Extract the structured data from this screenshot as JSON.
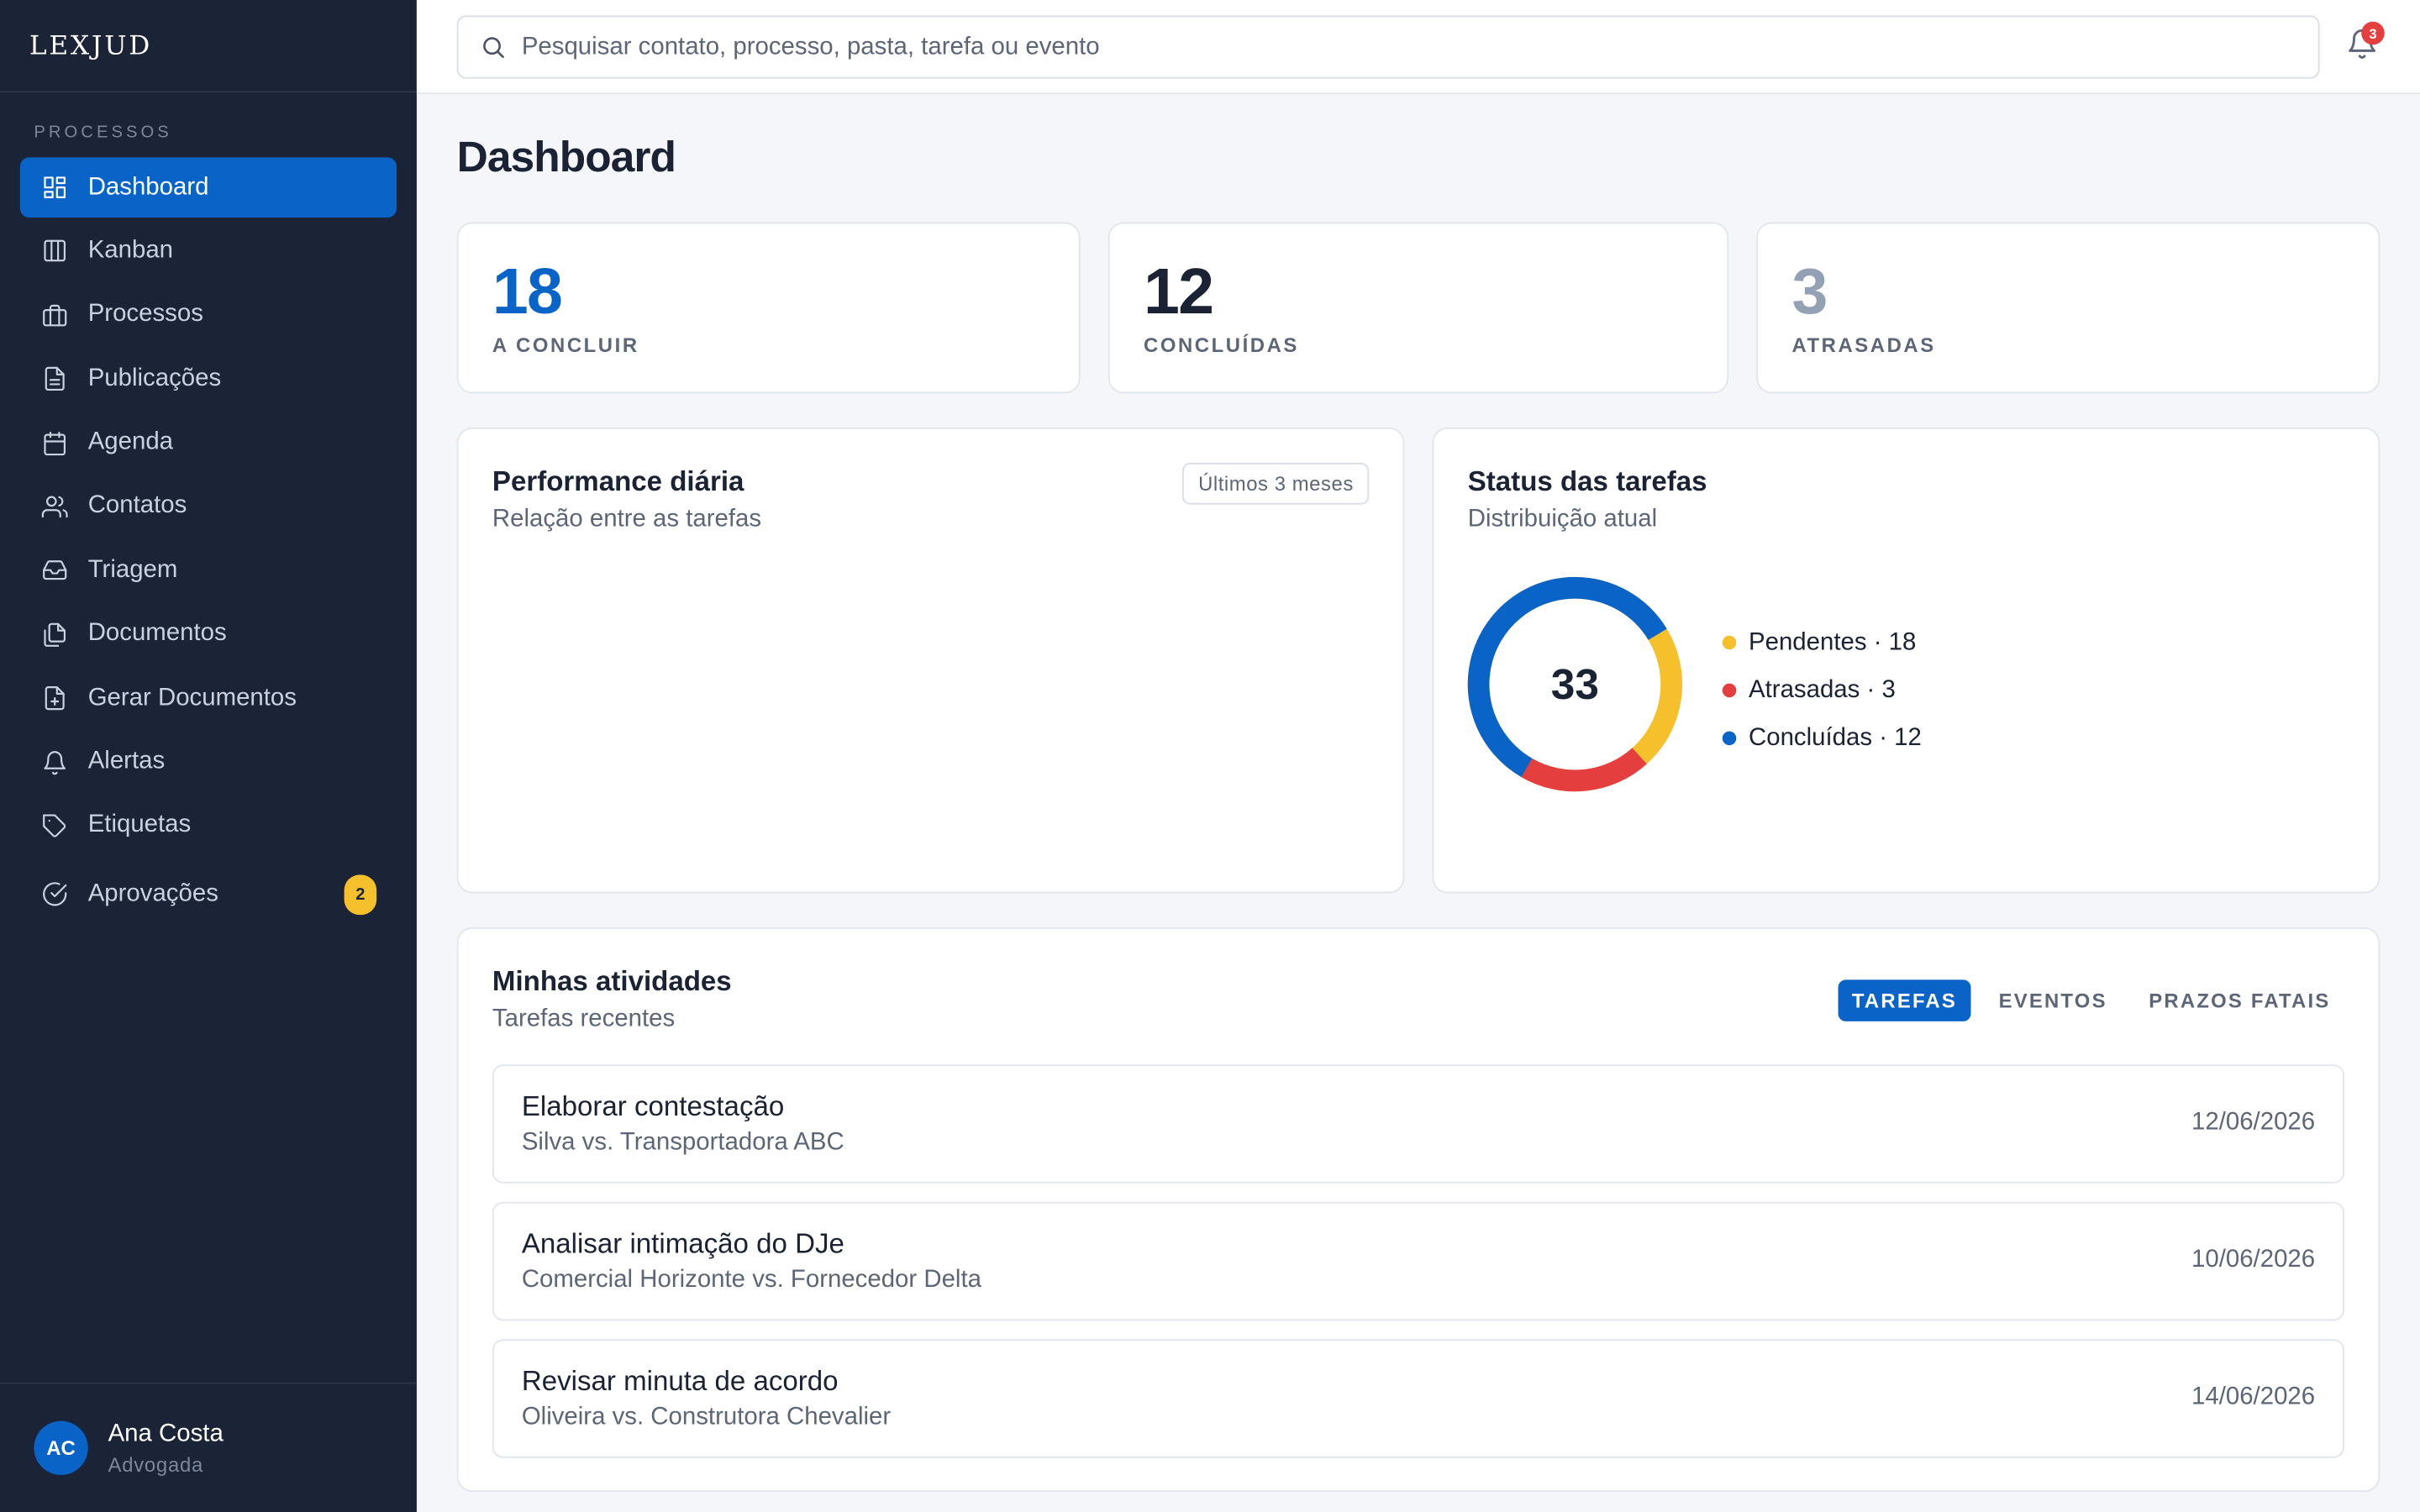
{
  "brand": {
    "logo": "LEXJUD"
  },
  "sidebar": {
    "section_label": "PROCESSOS",
    "items": [
      {
        "label": "Dashboard",
        "icon": "dashboard-icon"
      },
      {
        "label": "Kanban",
        "icon": "kanban-icon"
      },
      {
        "label": "Processos",
        "icon": "briefcase-icon"
      },
      {
        "label": "Publicações",
        "icon": "document-icon"
      },
      {
        "label": "Agenda",
        "icon": "calendar-icon"
      },
      {
        "label": "Contatos",
        "icon": "users-icon"
      },
      {
        "label": "Triagem",
        "icon": "inbox-icon"
      },
      {
        "label": "Documentos",
        "icon": "files-icon"
      },
      {
        "label": "Gerar Documentos",
        "icon": "file-plus-icon"
      },
      {
        "label": "Alertas",
        "icon": "bell-icon"
      },
      {
        "label": "Etiquetas",
        "icon": "tag-icon"
      },
      {
        "label": "Aprovações",
        "icon": "check-circle-icon",
        "badge": "2"
      }
    ],
    "active_index": 0
  },
  "user": {
    "initials": "AC",
    "name": "Ana Costa",
    "role": "Advogada"
  },
  "topbar": {
    "search_placeholder": "Pesquisar contato, processo, pasta, tarefa ou evento",
    "notification_count": "3"
  },
  "page": {
    "title": "Dashboard"
  },
  "stats": [
    {
      "value": "18",
      "label": "A CONCLUIR",
      "color": "#0a64c8"
    },
    {
      "value": "12",
      "label": "CONCLUÍDAS",
      "color": "#1a2233"
    },
    {
      "value": "3",
      "label": "ATRASADAS",
      "color": "#94a0b4"
    }
  ],
  "performance": {
    "title": "Performance diária",
    "subtitle": "Relação entre as tarefas",
    "range": "Últimos 3 meses"
  },
  "status": {
    "title": "Status das tarefas",
    "subtitle": "Distribuição atual",
    "total": "33",
    "legend": [
      {
        "label": "Pendentes · 18",
        "color": "#f5c02c"
      },
      {
        "label": "Atrasadas · 3",
        "color": "#e53e3e"
      },
      {
        "label": "Concluídas · 12",
        "color": "#0a64c8"
      }
    ]
  },
  "activities": {
    "title": "Minhas atividades",
    "subtitle": "Tarefas recentes",
    "tabs": [
      "TAREFAS",
      "EVENTOS",
      "PRAZOS FATAIS"
    ],
    "active_tab": 0,
    "items": [
      {
        "title": "Elaborar contestação",
        "case": "Silva vs. Transportadora ABC",
        "date": "12/06/2026"
      },
      {
        "title": "Analisar intimação do DJe",
        "case": "Comercial Horizonte vs. Fornecedor Delta",
        "date": "10/06/2026"
      },
      {
        "title": "Revisar minuta de acordo",
        "case": "Oliveira vs. Construtora Chevalier",
        "date": "14/06/2026"
      }
    ]
  }
}
